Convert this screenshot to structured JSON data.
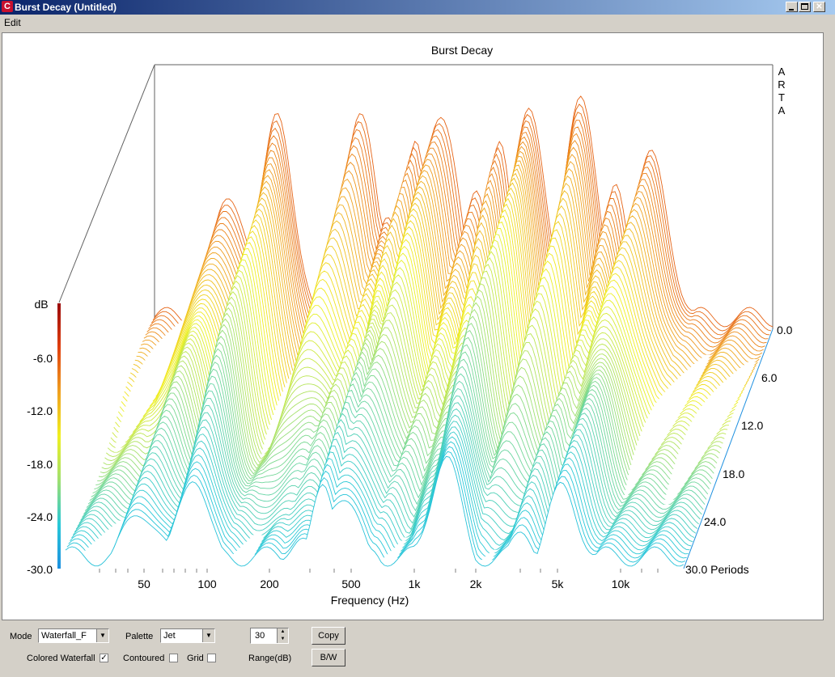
{
  "window": {
    "title": "Burst Decay  (Untitled)",
    "icon": "arta-app-icon",
    "controls": [
      "minimize-icon",
      "maximize-icon",
      "close-icon"
    ]
  },
  "menu": {
    "items": [
      "Edit"
    ]
  },
  "plot": {
    "title": "Burst Decay",
    "brand_letters": [
      "A",
      "R",
      "T",
      "A"
    ],
    "colorbar": {
      "label": "dB",
      "ticks": [
        "-6.0",
        "-12.0",
        "-18.0",
        "-24.0",
        "-30.0"
      ]
    },
    "x_axis": {
      "label": "Frequency (Hz)",
      "ticks": [
        "50",
        "100",
        "200",
        "500",
        "1k",
        "2k",
        "5k",
        "10k"
      ]
    },
    "z_axis": {
      "ticks": [
        "0.0",
        "6.0",
        "12.0",
        "18.0",
        "24.0",
        "30.0 Periods"
      ]
    },
    "palette_colors": [
      "#1e90e0",
      "#28c8d8",
      "#a0e070",
      "#f0f020",
      "#f0a020",
      "#e04010",
      "#9a0a0a"
    ]
  },
  "controls": {
    "mode_label": "Mode",
    "mode_value": "Waterfall_F",
    "palette_label": "Palette",
    "palette_value": "Jet",
    "range_value": "30",
    "range_label": "Range(dB)",
    "copy_label": "Copy",
    "bw_label": "B/W",
    "colored_waterfall_label": "Colored Waterfall",
    "colored_waterfall_checked": true,
    "contoured_label": "Contoured",
    "contoured_checked": false,
    "grid_label": "Grid",
    "grid_checked": false
  }
}
